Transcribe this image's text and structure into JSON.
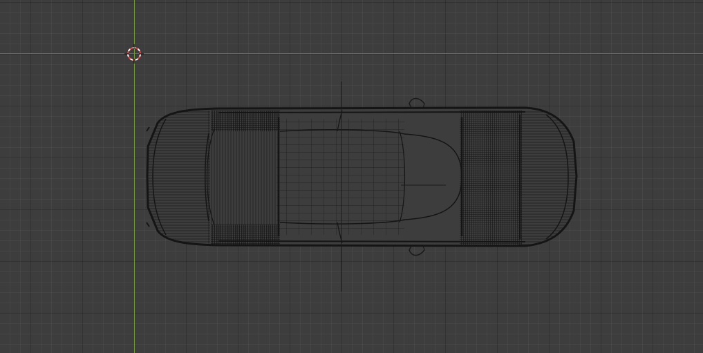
{
  "viewport": {
    "background": "#3d3d3d",
    "grid_major": "#323232",
    "grid_minor": "#454545",
    "axis_x_color": "#b0474c",
    "axis_y_color": "#6f9a2f"
  },
  "object": {
    "shading": "wireframe",
    "wire_color": "#1a1a1a",
    "icon": "car-icon"
  },
  "cursor": {
    "icon": "3d-cursor-icon",
    "ring_color_a": "#e64545",
    "ring_color_b": "#ffffff"
  }
}
